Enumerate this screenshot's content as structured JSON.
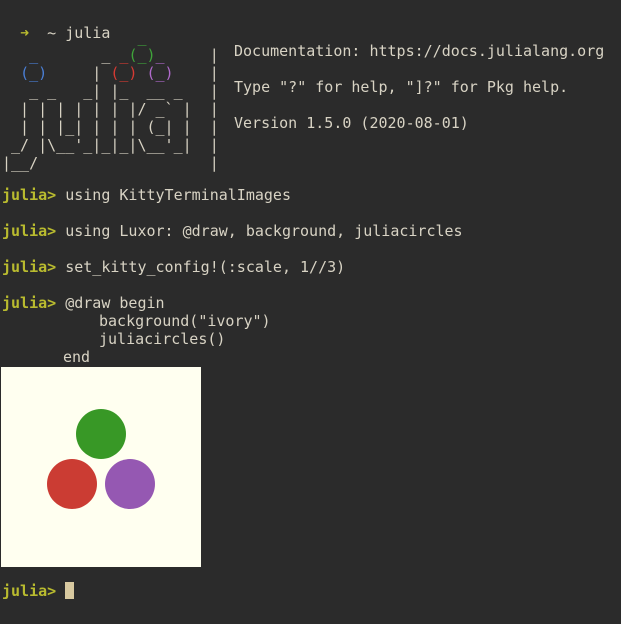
{
  "shell": {
    "arrow": "➜",
    "cwd": "~",
    "command": "julia"
  },
  "banner": {
    "doc_line": "Documentation: https://docs.julialang.org",
    "help_line": "Type \"?\" for help, \"]?\" for Pkg help.",
    "version_line": "Version 1.5.0 (2020-08-01)"
  },
  "repl": {
    "prompt": "julia>",
    "commands": [
      "using KittyTerminalImages",
      "using Luxor: @draw, background, juliacircles",
      "set_kitty_config!(:scale, 1//3)",
      "@draw begin"
    ],
    "block_lines": [
      "background(\"ivory\")",
      "juliacircles()",
      "end"
    ]
  },
  "image": {
    "background": "#fffff0",
    "circles": [
      {
        "name": "green",
        "color": "#389826"
      },
      {
        "name": "red",
        "color": "#cb3c33"
      },
      {
        "name": "purple",
        "color": "#9558b2"
      }
    ]
  },
  "colors": {
    "terminal_bg": "#2b2b2b",
    "text": "#d8d3c4",
    "prompt": "#b9bb2f",
    "cursor": "#d8c9a0"
  }
}
